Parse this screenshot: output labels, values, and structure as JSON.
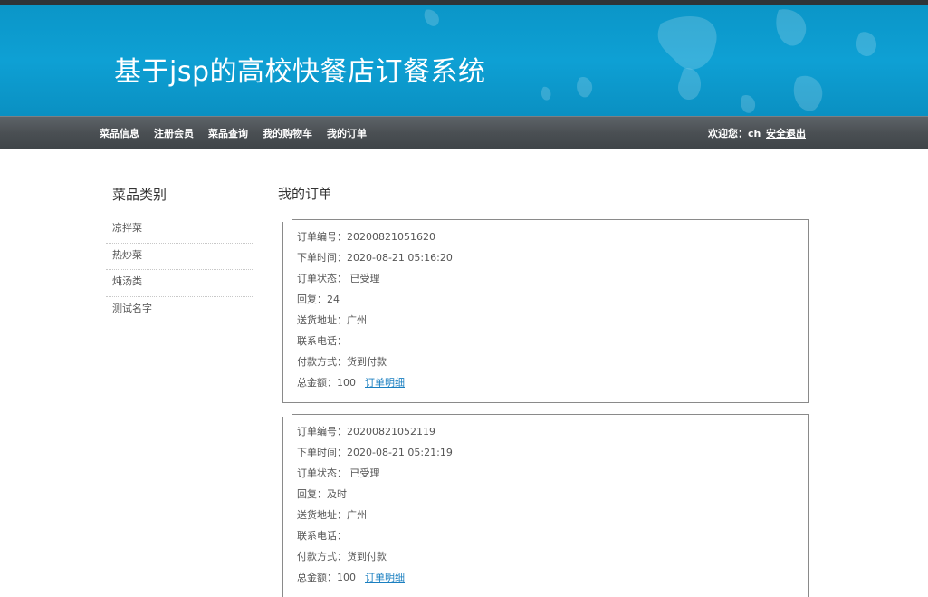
{
  "header": {
    "title": "基于jsp的高校快餐店订餐系统"
  },
  "nav": {
    "items": [
      "菜品信息",
      "注册会员",
      "菜品查询",
      "我的购物车",
      "我的订单"
    ],
    "welcome": "欢迎您：ch",
    "logout": "安全退出"
  },
  "sidebar": {
    "title": "菜品类别",
    "items": [
      "凉拌菜",
      "热炒菜",
      "炖汤类",
      "测试名字"
    ]
  },
  "main": {
    "title": "我的订单",
    "detail_label": "订单明细",
    "orders": [
      {
        "number": "订单编号：20200821051620",
        "time": "下单时间：2020-08-21 05:16:20",
        "status": "订单状态： 已受理",
        "reply": "回复：24",
        "address": "送货地址：广州",
        "phone": "联系电话：",
        "payment": "付款方式：货到付款",
        "total": "总金额：100"
      },
      {
        "number": "订单编号：20200821052119",
        "time": "下单时间：2020-08-21 05:21:19",
        "status": "订单状态： 已受理",
        "reply": "回复：及时",
        "address": "送货地址：广州",
        "phone": "联系电话：",
        "payment": "付款方式：货到付款",
        "total": "总金额：100"
      }
    ]
  },
  "colors": {
    "header_blue": "#0ea0d4",
    "nav_dark": "#4a4f53",
    "link_blue": "#1a7fc0"
  }
}
